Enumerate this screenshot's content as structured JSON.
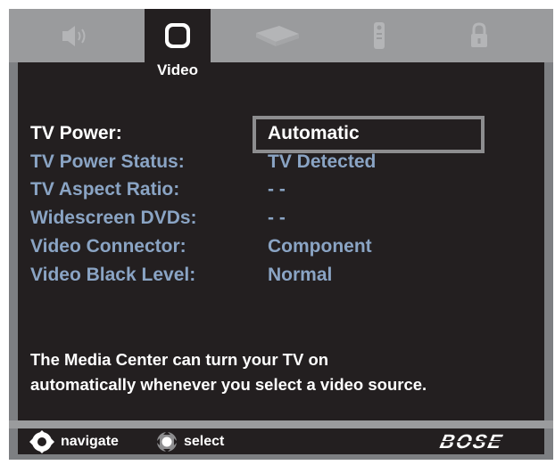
{
  "tabs": {
    "active_label": "Video",
    "icons": [
      "speaker-icon",
      "tv-icon",
      "disc-player-icon",
      "remote-icon",
      "lock-icon"
    ]
  },
  "settings": {
    "rows": [
      {
        "label": "TV Power:",
        "value": "Automatic"
      },
      {
        "label": "TV Power Status:",
        "value": "TV Detected"
      },
      {
        "label": "TV Aspect Ratio:",
        "value": "- -"
      },
      {
        "label": "Widescreen DVDs:",
        "value": "- -"
      },
      {
        "label": "Video Connector:",
        "value": "Component"
      },
      {
        "label": "Video Black Level:",
        "value": "Normal"
      }
    ]
  },
  "description": {
    "line1": "The Media Center can turn your TV on",
    "line2": "automatically whenever you select a video source."
  },
  "footer": {
    "navigate_label": "navigate",
    "select_label": "select",
    "brand": "BOSE"
  },
  "colors": {
    "background": "#231f20",
    "frame": "#7d7f82",
    "tab_strip": "#9a9b9d",
    "dim_text": "#8aa4c4",
    "highlight_text": "#ffffff"
  }
}
